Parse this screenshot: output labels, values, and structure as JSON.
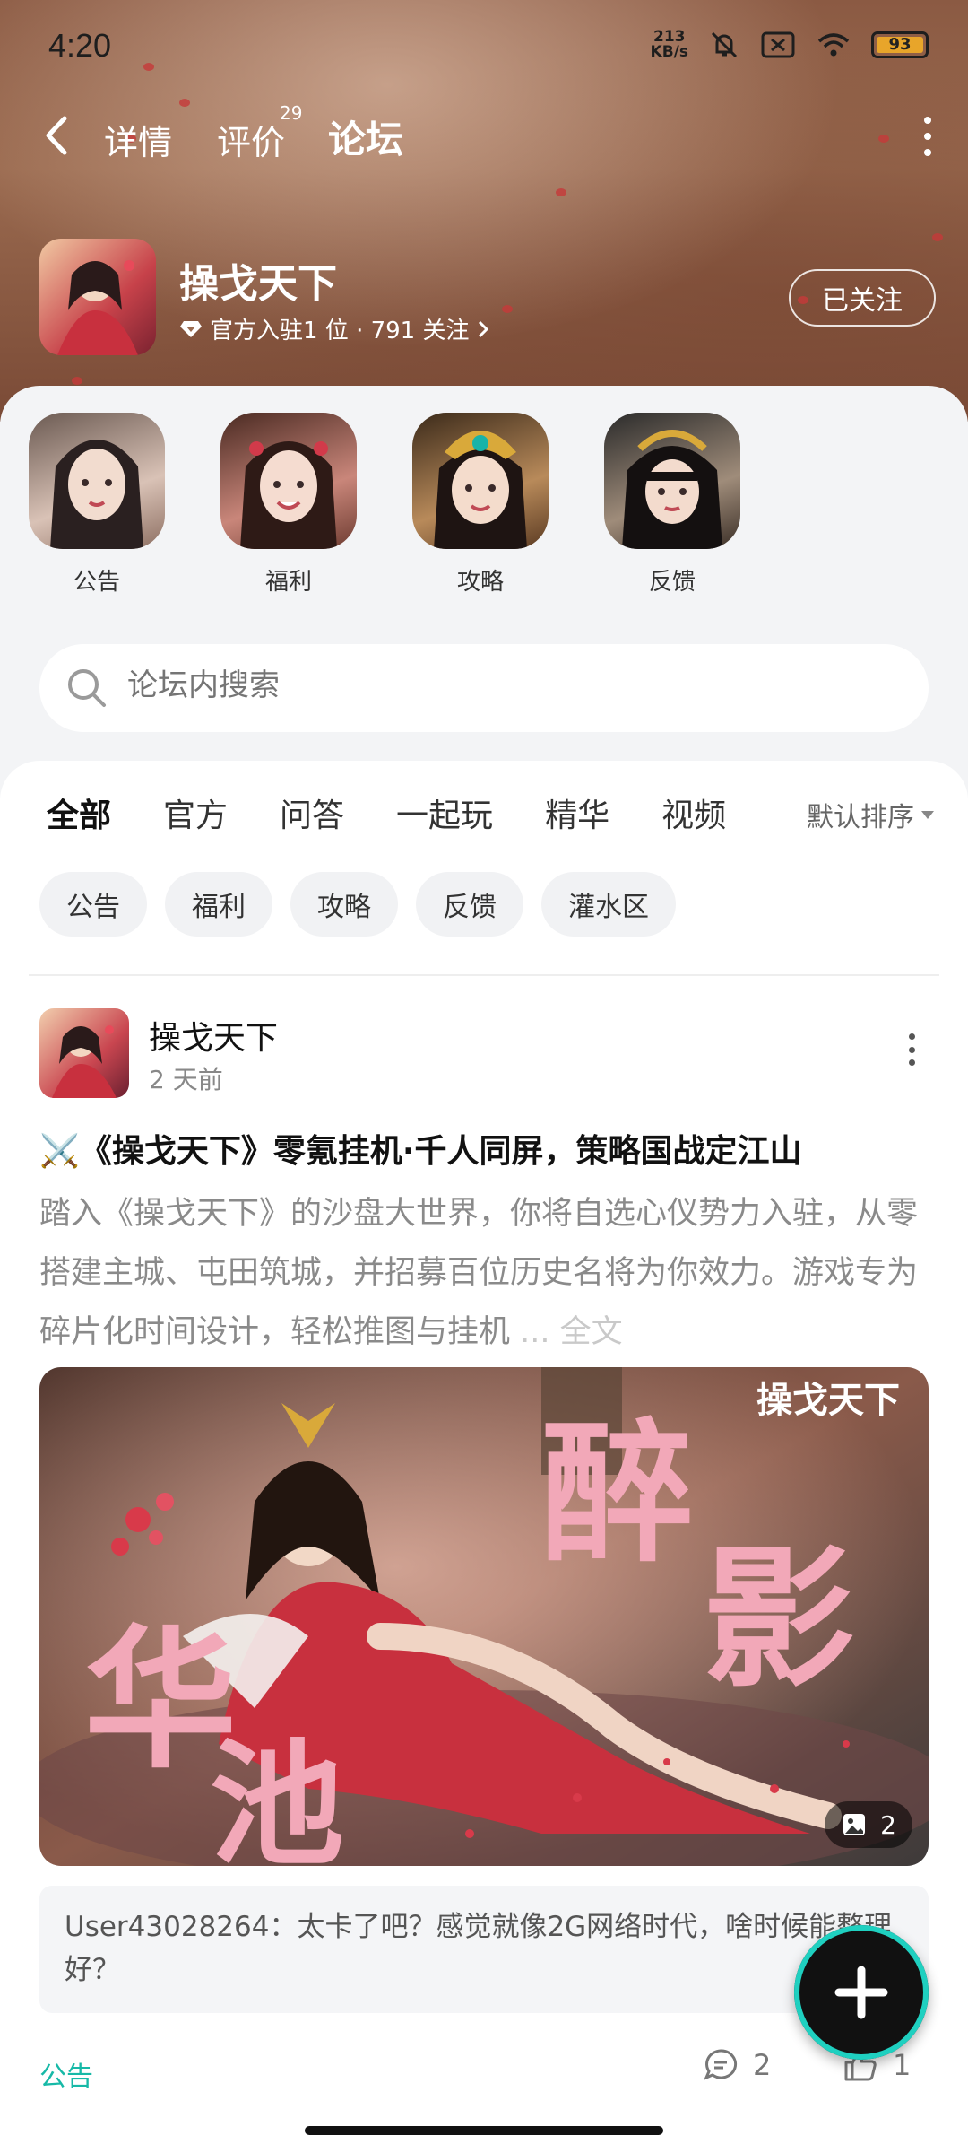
{
  "status_bar": {
    "time": "4:20",
    "net_speed_value": "213",
    "net_speed_unit": "KB/s",
    "battery": "93"
  },
  "nav": {
    "tabs": [
      {
        "label": "详情"
      },
      {
        "label": "评价",
        "badge": "29"
      },
      {
        "label": "论坛"
      }
    ],
    "active_tab": "论坛"
  },
  "game": {
    "name": "操戈天下",
    "meta": "官方入驻1 位 · 791 关注",
    "follow_label": "已关注"
  },
  "categories": [
    {
      "label": "公告"
    },
    {
      "label": "福利"
    },
    {
      "label": "攻略"
    },
    {
      "label": "反馈"
    }
  ],
  "search": {
    "placeholder": "论坛内搜索"
  },
  "feed_tabs": [
    "全部",
    "官方",
    "问答",
    "一起玩",
    "精华",
    "视频"
  ],
  "sort_label": "默认排序",
  "chips": [
    "公告",
    "福利",
    "攻略",
    "反馈",
    "灌水区"
  ],
  "post": {
    "author": "操戈天下",
    "time": "2 天前",
    "title": "⚔️《操戈天下》零氪挂机·千人同屏，策略国战定江山",
    "body": "踏入《操戈天下》的沙盘大世界，你将自选心仪势力入驻，从零搭建主城、屯田筑城，并招募百位历史名将为你效力。游戏专为碎片化时间设计，轻松推图与挂机",
    "ellipsis": " ... ",
    "fulltext_label": "全文",
    "image": {
      "logo_text": "操戈天下",
      "calligraphy": [
        "华",
        "池",
        "醉",
        "影"
      ],
      "count": "2"
    },
    "top_comment": "User43028264：太卡了吧？感觉就像2G网络时代，啥时候能整理好？",
    "tag": "公告",
    "comments": "2",
    "likes": "1"
  },
  "colors": {
    "accent": "#17c6b4",
    "tag": "#17b9a7"
  }
}
